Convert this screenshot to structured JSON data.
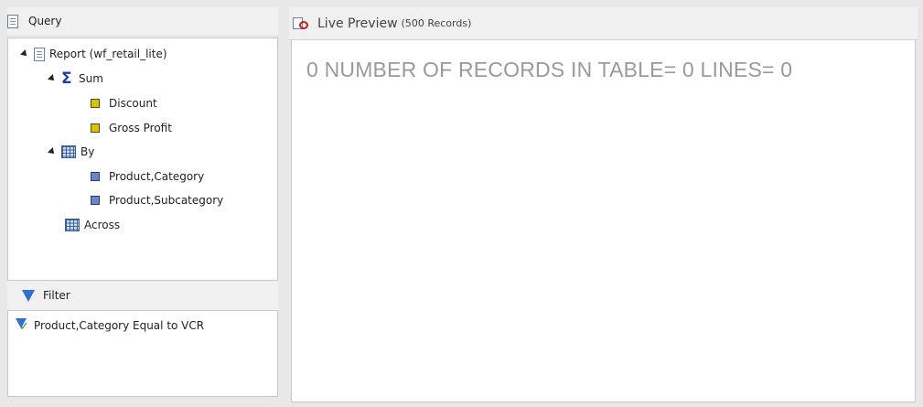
{
  "query": {
    "title": "Query",
    "tree": {
      "root": "Report (wf_retail_lite)",
      "sum_label": "Sum",
      "sum_items": [
        "Discount",
        "Gross Profit"
      ],
      "by_label": "By",
      "by_items": [
        "Product,Category",
        "Product,Subcategory"
      ],
      "across_label": "Across"
    }
  },
  "filter": {
    "title": "Filter",
    "item": "Product,Category Equal to VCR"
  },
  "preview": {
    "title": "Live Preview",
    "subtitle": "(500 Records)",
    "message": "0 NUMBER OF RECORDS IN TABLE= 0 LINES= 0"
  },
  "colors": {
    "message_text": "#9a9a9a",
    "sigma": "#1c3ea8",
    "measure_icon": "#d8c400",
    "dimension_icon": "#6a86c8"
  }
}
